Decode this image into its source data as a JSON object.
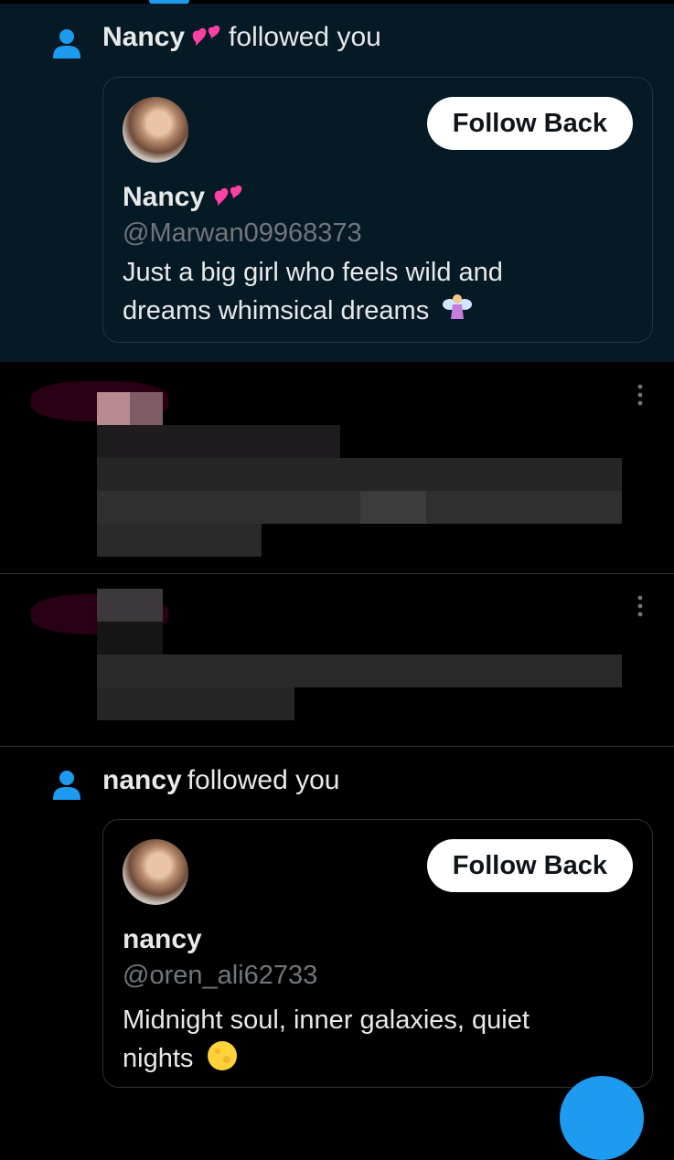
{
  "notifications": [
    {
      "name": "Nancy",
      "action_text": "followed you",
      "card": {
        "follow_button": "Follow Back",
        "display_name": "Nancy",
        "handle": "@Marwan09968373",
        "bio_line1": "Just a big girl who feels wild and",
        "bio_line2": "dreams whimsical dreams"
      },
      "name_emoji": "two-hearts",
      "bio_emoji": "fairy"
    },
    {
      "name": "nancy",
      "action_text": "followed you",
      "card": {
        "follow_button": "Follow Back",
        "display_name": "nancy",
        "handle": "@oren_ali62733",
        "bio_line1": "Midnight soul, inner galaxies, quiet",
        "bio_line2": "nights"
      },
      "bio_emoji": "full-moon"
    }
  ],
  "icons": {
    "person": "person-icon",
    "more": "more-vertical-icon"
  },
  "colors": {
    "accent": "#1d9bf0",
    "highlight_bg": "#061a26",
    "text_secondary": "#71767b",
    "heart_pink": "#ff3fa4"
  }
}
